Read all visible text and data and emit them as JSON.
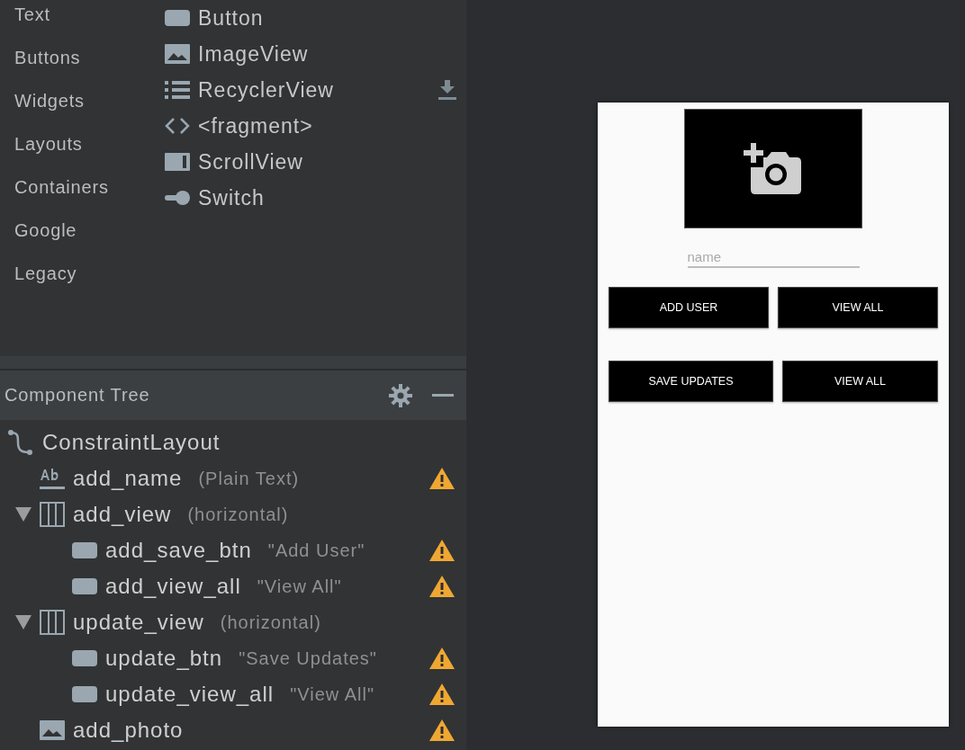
{
  "palette": {
    "categories": [
      {
        "label": "Text"
      },
      {
        "label": "Buttons"
      },
      {
        "label": "Widgets"
      },
      {
        "label": "Layouts"
      },
      {
        "label": "Containers"
      },
      {
        "label": "Google"
      },
      {
        "label": "Legacy"
      }
    ],
    "items": [
      {
        "label": "Button",
        "kind": "button",
        "download": false
      },
      {
        "label": "ImageView",
        "kind": "image",
        "download": false
      },
      {
        "label": "RecyclerView",
        "kind": "list",
        "download": true
      },
      {
        "label": "<fragment>",
        "kind": "fragment",
        "download": false
      },
      {
        "label": "ScrollView",
        "kind": "scroll",
        "download": false
      },
      {
        "label": "Switch",
        "kind": "switch",
        "download": false
      }
    ]
  },
  "component_tree": {
    "title": "Component Tree",
    "nodes": [
      {
        "name": "ConstraintLayout",
        "kind": "constraint",
        "warning": false,
        "children": [
          {
            "name": "add_name",
            "detail": "(Plain Text)",
            "kind": "text",
            "warning": true
          },
          {
            "name": "add_view",
            "detail": "(horizontal)",
            "kind": "linear",
            "warning": false,
            "expanded": true,
            "children": [
              {
                "name": "add_save_btn",
                "detail": "\"Add User\"",
                "kind": "button",
                "warning": true
              },
              {
                "name": "add_view_all",
                "detail": "\"View All\"",
                "kind": "button",
                "warning": true
              }
            ]
          },
          {
            "name": "update_view",
            "detail": "(horizontal)",
            "kind": "linear",
            "warning": false,
            "expanded": true,
            "children": [
              {
                "name": "update_btn",
                "detail": "\"Save Updates\"",
                "kind": "button",
                "warning": true
              },
              {
                "name": "update_view_all",
                "detail": "\"View All\"",
                "kind": "button",
                "warning": true
              }
            ]
          },
          {
            "name": "add_photo",
            "kind": "image",
            "warning": true
          }
        ]
      }
    ]
  },
  "preview": {
    "name_field": {
      "placeholder": "name"
    },
    "button_rows": [
      {
        "buttons": [
          {
            "label": "ADD USER"
          },
          {
            "label": "VIEW ALL"
          }
        ]
      },
      {
        "buttons": [
          {
            "label": "SAVE UPDATES"
          },
          {
            "label": "VIEW ALL"
          }
        ]
      }
    ]
  }
}
